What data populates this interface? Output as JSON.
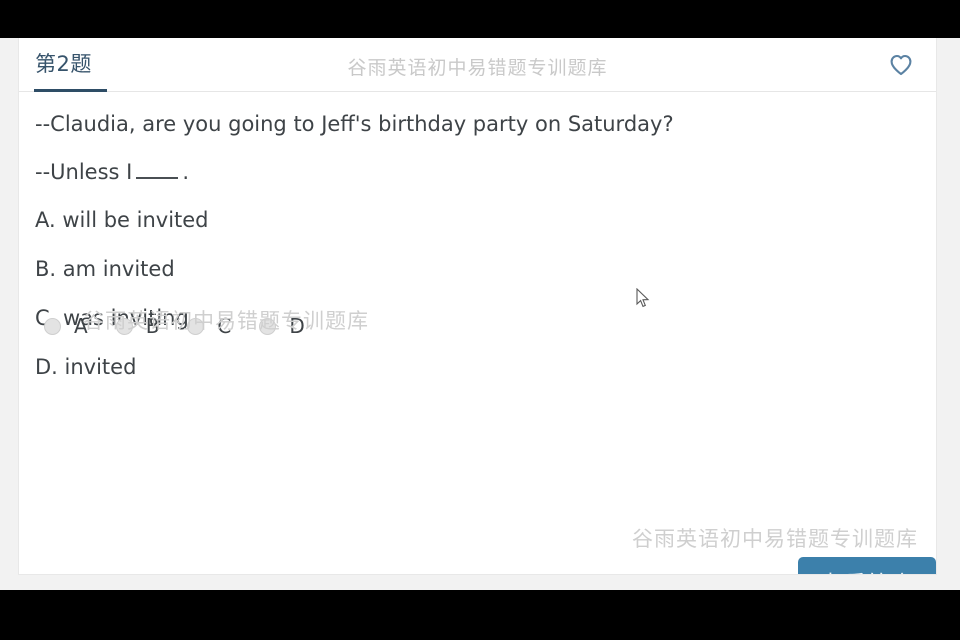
{
  "header": {
    "tab_label": "第2题",
    "watermark": "谷雨英语初中易错题专训题库",
    "favorite_icon": "heart-icon"
  },
  "question": {
    "line1": "--Claudia, are you going to Jeff's birthday party on Saturday?",
    "line2_prefix": "--Unless I",
    "line2_suffix": ".",
    "options": [
      {
        "label": "A. will be invited"
      },
      {
        "label": "B. am invited"
      },
      {
        "label": "C. was inviting"
      },
      {
        "label": "D. invited"
      }
    ]
  },
  "answer_choices": [
    {
      "value": "A",
      "selected": false
    },
    {
      "value": "B",
      "selected": false
    },
    {
      "value": "C",
      "selected": false
    },
    {
      "value": "D",
      "selected": false
    }
  ],
  "watermarks": {
    "middle": "谷雨英语初中易错题专训题库",
    "bottom_right": "谷雨英语初中易错题专训题库"
  },
  "actions": {
    "view_answer_label": "查看答案"
  },
  "colors": {
    "accent_blue": "#3c80ab",
    "tab_text": "#36536b",
    "tab_underline": "#2e4d66",
    "body_text": "#3e4347",
    "watermark_gray": "#c9c9c9",
    "page_bg": "#f2f2f2",
    "card_bg": "#ffffff",
    "letterbox": "#000000"
  }
}
